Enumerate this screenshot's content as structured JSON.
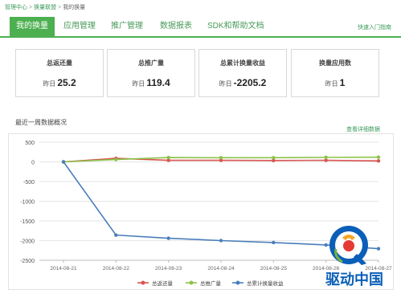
{
  "breadcrumb": {
    "items": [
      "管理中心",
      "换量联盟",
      "我的换量"
    ],
    "separator": ">"
  },
  "tabs": [
    {
      "label": "我的换量",
      "active": true
    },
    {
      "label": "应用管理",
      "active": false
    },
    {
      "label": "推广管理",
      "active": false
    },
    {
      "label": "数据报表",
      "active": false
    },
    {
      "label": "SDK和帮助文档",
      "active": false
    }
  ],
  "quick_link": "快速入门指南",
  "stats": [
    {
      "title": "总返还量",
      "prefix": "昨日",
      "value": "25.2"
    },
    {
      "title": "总推广量",
      "prefix": "昨日",
      "value": "119.4"
    },
    {
      "title": "总累计换量收益",
      "prefix": "昨日",
      "value": "-2205.2"
    },
    {
      "title": "换量应用数",
      "prefix": "昨日",
      "value": "1"
    }
  ],
  "section_title": "最近一周数据概况",
  "detail_link": "查看详细数据",
  "brand": {
    "text": "驱动中国",
    "logo_letter": "Q"
  },
  "colors": {
    "accent": "#4caf50",
    "series_red": "#d9534f",
    "series_green": "#8bc34a",
    "series_blue": "#4a7ebb"
  },
  "chart_data": {
    "type": "line",
    "x": [
      "2014-08-21",
      "2014-08-22",
      "2014-08-23",
      "2014-08-24",
      "2014-08-25",
      "2014-08-26",
      "2014-08-27"
    ],
    "ylim": [
      -2500,
      500
    ],
    "yticks": [
      500,
      0,
      -500,
      -1000,
      -1500,
      -2000,
      -2500
    ],
    "grid": true,
    "legend_position": "bottom",
    "series": [
      {
        "name": "总返还量",
        "color": "#d9534f",
        "values": [
          0,
          90,
          40,
          40,
          35,
          40,
          25
        ]
      },
      {
        "name": "总推广量",
        "color": "#8bc34a",
        "values": [
          0,
          60,
          110,
          105,
          105,
          115,
          119
        ]
      },
      {
        "name": "总累计换量收益",
        "color": "#4a7ebb",
        "values": [
          0,
          -1860,
          -1940,
          -2000,
          -2050,
          -2110,
          -2205
        ]
      }
    ]
  }
}
